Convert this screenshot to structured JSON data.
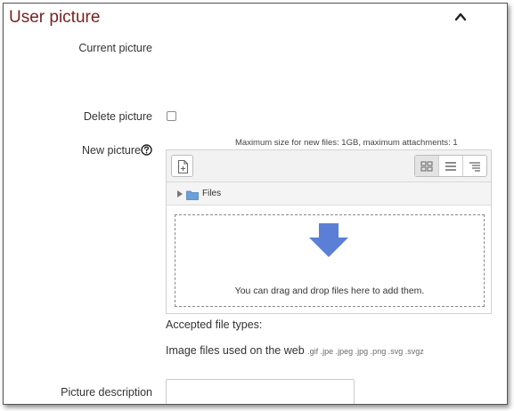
{
  "section": {
    "title": "User picture",
    "collapse_icon": "chevron-up-icon"
  },
  "fields": {
    "current_picture_label": "Current picture",
    "delete_picture_label": "Delete picture",
    "delete_picture_checked": false,
    "new_picture_label": "New picture",
    "help_icon": "question-circle-icon",
    "picture_description_label": "Picture description",
    "picture_description_value": ""
  },
  "filepicker": {
    "max_size_text": "Maximum size for new files: 1GB, maximum attachments: 1",
    "add_file_icon": "add-file-icon",
    "view_buttons": [
      {
        "icon": "grid-view-icon",
        "active": true
      },
      {
        "icon": "list-view-icon",
        "active": false
      },
      {
        "icon": "tree-view-icon",
        "active": false
      }
    ],
    "path_label": "Files",
    "drop_text": "You can drag and drop files here to add them."
  },
  "accepted": {
    "label": "Accepted file types:",
    "description": "Image files used on the web",
    "extensions": ".gif .jpe .jpeg .jpg .png .svg .svgz"
  },
  "colors": {
    "title": "#7a1f1f",
    "drop_arrow": "#5b7fd6"
  }
}
